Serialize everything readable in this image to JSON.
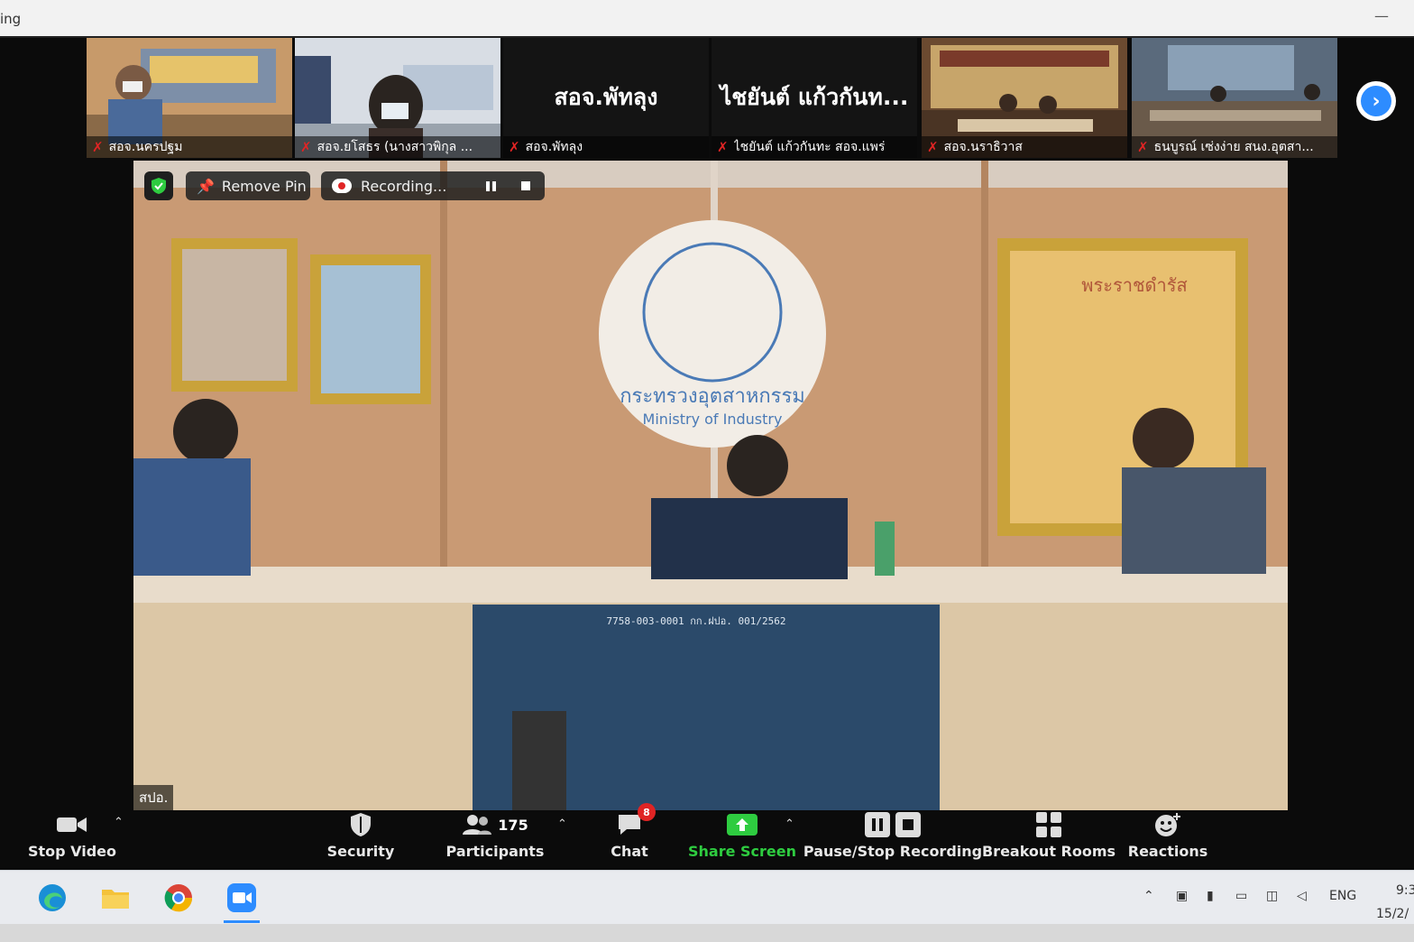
{
  "window": {
    "title": "ing",
    "minimize_glyph": "—"
  },
  "thumbnails": [
    {
      "name": "สอจ.นครปฐม",
      "mic": "muted",
      "video": true
    },
    {
      "name": "สอจ.ยโสธร (นางสาวพิกุล ...",
      "mic": "muted",
      "video": true
    },
    {
      "name": "สอจ.พัทลุง",
      "display_name": "สอจ.พัทลุง",
      "mic": "muted",
      "video": false
    },
    {
      "name": "ไชยันต์ แก้วกันทะ สอจ.แพร่",
      "display_name": "ไชยันต์ แก้วกันท...",
      "mic": "muted",
      "video": false
    },
    {
      "name": "สอจ.นราธิวาส",
      "mic": "muted",
      "video": true
    },
    {
      "name": "ธนบูรณ์ เซ่งง่าย สนง.อุตสา...",
      "mic": "muted",
      "video": true
    }
  ],
  "next_page_icon": "chevron-right-icon",
  "main_video": {
    "participant_name": "สปอ.",
    "remove_pin_label": "Remove Pin",
    "recording_label": "Recording...",
    "seal_text_thai": "กระทรวงอุตสาหกรรม",
    "seal_text_en": "Ministry of Industry",
    "plaque_title": "พระราชดำรัส",
    "screen_text": "7758-003-0001 กก.ฝปอ. 001/2562"
  },
  "toolbar": {
    "stop_video": "Stop Video",
    "security": "Security",
    "participants": "Participants",
    "participants_count": "175",
    "chat": "Chat",
    "chat_badge": "8",
    "share_screen": "Share Screen",
    "pause_stop_recording": "Pause/Stop Recording",
    "breakout_rooms": "Breakout Rooms",
    "reactions": "Reactions"
  },
  "taskbar": {
    "language": "ENG",
    "time": "9:3",
    "date": "15/2/"
  },
  "colors": {
    "accent_blue": "#2d8cff",
    "share_green": "#2ecc40",
    "mute_red": "#e02424",
    "wall_wood": "#c99a74"
  }
}
